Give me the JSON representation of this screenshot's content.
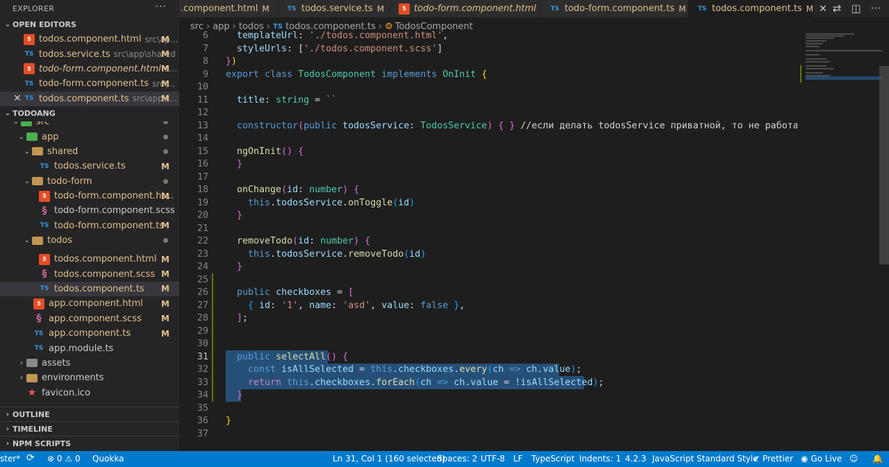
{
  "sidebar": {
    "title": "EXPLORER",
    "more": "···",
    "open_editors": {
      "header": "OPEN EDITORS",
      "items": [
        {
          "name": "todos.component.html",
          "desc": "src\\ap...",
          "badge": "M",
          "icon": "html-icon"
        },
        {
          "name": "todos.service.ts",
          "desc": "src\\app\\shared",
          "badge": "M",
          "icon": "ts-icon"
        },
        {
          "name": "todo-form.component.html",
          "desc": "src\\...",
          "badge": "M",
          "icon": "html-icon"
        },
        {
          "name": "todo-form.component.ts",
          "desc": "src\\...",
          "badge": "M",
          "icon": "ts-icon"
        },
        {
          "name": "todos.component.ts",
          "desc": "src\\app\\t...",
          "badge": "M",
          "icon": "ts-icon"
        }
      ]
    },
    "project": {
      "header": "TODOANG",
      "items": [
        {
          "name": "src"
        },
        {
          "name": "app"
        },
        {
          "name": "shared"
        },
        {
          "name": "todos.service.ts",
          "badge": "M"
        },
        {
          "name": "todo-form"
        },
        {
          "name": "todo-form.component.ht...",
          "badge": "M"
        },
        {
          "name": "todo-form.component.scss"
        },
        {
          "name": "todo-form.component.ts",
          "badge": "M"
        },
        {
          "name": "todos"
        },
        {
          "name": "todos.component.html",
          "badge": "M"
        },
        {
          "name": "todos.component.scss",
          "badge": "M"
        },
        {
          "name": "todos.component.ts",
          "badge": "M"
        },
        {
          "name": "app.component.html",
          "badge": "M"
        },
        {
          "name": "app.component.scss",
          "badge": "M"
        },
        {
          "name": "app.component.ts",
          "badge": "M"
        },
        {
          "name": "app.module.ts"
        },
        {
          "name": "assets"
        },
        {
          "name": "environments"
        },
        {
          "name": "favicon.ico"
        }
      ]
    },
    "bottom": [
      "OUTLINE",
      "TIMELINE",
      "NPM SCRIPTS"
    ]
  },
  "tabs": [
    {
      "name": ".component.html",
      "badge": "M",
      "type": "html"
    },
    {
      "name": "todos.service.ts",
      "badge": "M",
      "type": "ts"
    },
    {
      "name": "todo-form.component.html",
      "badge": "M",
      "type": "html"
    },
    {
      "name": "todo-form.component.ts",
      "badge": "M",
      "type": "ts"
    },
    {
      "name": "todos.component.ts",
      "badge": "M",
      "type": "ts"
    }
  ],
  "breadcrumb": [
    "src",
    "app",
    "todos",
    "todos.component.ts",
    "TodosComponent"
  ],
  "editor": {
    "line_numbers": [
      "6",
      "7",
      "8",
      "9",
      "10",
      "11",
      "12",
      "13",
      "14",
      "15",
      "16",
      "17",
      "18",
      "19",
      "20",
      "21",
      "22",
      "23",
      "24",
      "25",
      "26",
      "27",
      "28",
      "29",
      "30",
      "31",
      "32",
      "33",
      "34",
      "35",
      "36",
      "37"
    ],
    "current_line": "31"
  },
  "statusbar": {
    "branch": "ster*",
    "sync": "⟳",
    "errors": "0",
    "warnings": "0",
    "quokka": "Quokka",
    "position": "Ln 31, Col 1 (160 selected)",
    "spaces": "Spaces: 2",
    "encoding": "UTF-8",
    "eol": "LF",
    "language": "TypeScript",
    "indents": "Indents: 1",
    "version": "4.2.3",
    "style": "JavaScript Standard Style",
    "prettier": "Prettier",
    "golive": "Go Live"
  },
  "colors": {
    "statusbar": "#007acc",
    "modified": "#e2c08d",
    "selection": "#264f78"
  }
}
